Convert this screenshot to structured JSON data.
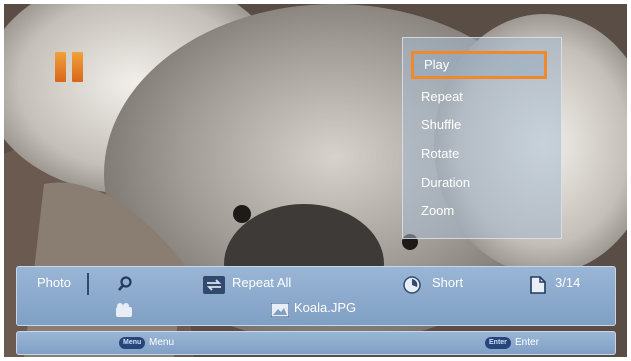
{
  "menu": {
    "items": [
      {
        "label": "Play",
        "selected": true
      },
      {
        "label": "Repeat"
      },
      {
        "label": "Shuffle"
      },
      {
        "label": "Rotate"
      },
      {
        "label": "Duration"
      },
      {
        "label": "Zoom"
      }
    ]
  },
  "info": {
    "category": "Photo",
    "repeat": "Repeat All",
    "duration": "Short",
    "counter": "3/14",
    "filename": "Koala.JPG"
  },
  "help": {
    "menu_key": "Menu",
    "menu_label": "Menu",
    "enter_key": "Enter",
    "enter_label": "Enter"
  },
  "colors": {
    "highlight": "#f0892c",
    "bar": "#8aa8cc",
    "pause": "#e8842a"
  },
  "icons": [
    "pause-icon",
    "search-icon",
    "repeat-icon",
    "timer-icon",
    "page-icon",
    "music-icon",
    "image-file-icon"
  ]
}
